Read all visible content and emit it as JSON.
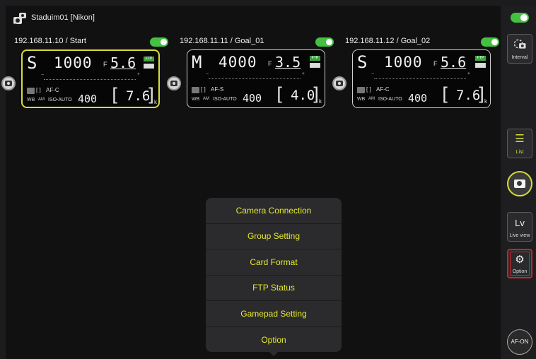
{
  "group": {
    "label": "Staduim01 [Nikon]",
    "icon": "camera-group-icon"
  },
  "cameras": [
    {
      "ip": "192.168.11.10 / Start",
      "enabled": true,
      "selected": true,
      "mode": "S",
      "shutter": "1000",
      "aperture_prefix": "F",
      "aperture": "5.6",
      "ftp": "FTP",
      "af_area": "[ ]",
      "af_mode": "AF-C",
      "wb": "WB",
      "am": "AM",
      "iso_label": "ISO-AUTO",
      "iso": "400",
      "shots": "7.6",
      "shots_unit": "k"
    },
    {
      "ip": "192.168.11.11 / Goal_01",
      "enabled": true,
      "selected": false,
      "mode": "M",
      "shutter": "4000",
      "aperture_prefix": "F",
      "aperture": "3.5",
      "ftp": "FTP",
      "af_area": "[ ]",
      "af_mode": "AF-S",
      "wb": "WB",
      "am": "AM",
      "iso_label": "ISO-AUTO",
      "iso": "400",
      "shots": "4.0",
      "shots_unit": "k"
    },
    {
      "ip": "192.168.11.12 / Goal_02",
      "enabled": true,
      "selected": false,
      "mode": "S",
      "shutter": "1000",
      "aperture_prefix": "F",
      "aperture": "5.6",
      "ftp": "FTP",
      "af_area": "[ ]",
      "af_mode": "AF-C",
      "wb": "WB",
      "am": "AM",
      "iso_label": "ISO-AUTO",
      "iso": "400",
      "shots": "7.6",
      "shots_unit": "k"
    }
  ],
  "menu": {
    "items": [
      "Camera Connection",
      "Group Setting",
      "Card Format",
      "FTP Status",
      "Gamepad Setting",
      "Option"
    ],
    "text_color": "#e6e830"
  },
  "sidebar": {
    "interval_label": "Interval",
    "list_label": "List",
    "lv_text": "Lv",
    "lv_label": "Live view",
    "option_label": "Option",
    "afon_label": "AF-ON",
    "highlight_color": "#c8222a",
    "accent_color": "#d8dc3a"
  }
}
